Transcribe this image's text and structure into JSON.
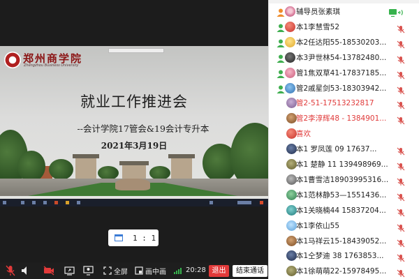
{
  "slide": {
    "top_banner": "",
    "university_cn": "郑州商学院",
    "university_en": "Zhengzhou Business University",
    "title": "就业工作推进会",
    "subtitle": "--会计学院17管会&19会计专升本",
    "date": "2021年3月19日"
  },
  "ratio_button": {
    "label": "1 : 1"
  },
  "controls": {
    "fullscreen_label": "全屏",
    "pip_label": "画中画",
    "time": "20:28",
    "exit_label": "退出",
    "end_label": "结束通话"
  },
  "colors": {
    "accent_red": "#e23a3a",
    "speaking_green": "#37b24d",
    "mic_red": "#d9534f"
  },
  "participants": [
    {
      "name": "辅导员张素琪",
      "role": "host-icon",
      "avatar": "flower",
      "red": false,
      "status": "sharing"
    },
    {
      "name": "本1李慧雪52",
      "role": "user-icon",
      "avatar": "red",
      "red": false,
      "status": "muted"
    },
    {
      "name": "本2任达阳55-18530203...",
      "role": "user-icon",
      "avatar": "emoji",
      "red": false,
      "status": "muted"
    },
    {
      "name": "本3尹世林54-13782480...",
      "role": "user-icon",
      "avatar": "dark",
      "red": false,
      "status": "muted"
    },
    {
      "name": "管1焦双草41-17837185...",
      "role": "user-icon",
      "avatar": "pink",
      "red": false,
      "status": "muted"
    },
    {
      "name": "管2戚星剑53-18303942...",
      "role": "user-icon",
      "avatar": "blue",
      "red": false,
      "status": "muted"
    },
    {
      "name": "管2-51-17513232817",
      "role": "",
      "avatar": "mauve",
      "red": true,
      "status": "muted"
    },
    {
      "name": "管2李淳辉48 - 1384901...",
      "role": "",
      "avatar": "brown",
      "red": true,
      "status": "muted"
    },
    {
      "name": "喜欢",
      "role": "",
      "avatar": "red",
      "red": true,
      "status": "none"
    },
    {
      "name": "本1  罗凤莲   09   17637...",
      "role": "",
      "avatar": "navy",
      "red": false,
      "status": "muted"
    },
    {
      "name": "本1 楚静 11 139498969...",
      "role": "",
      "avatar": "olive",
      "red": false,
      "status": "muted"
    },
    {
      "name": "本1曹雪洁18903995316...",
      "role": "",
      "avatar": "gray",
      "red": false,
      "status": "muted"
    },
    {
      "name": "本1范林静53—1551436...",
      "role": "",
      "avatar": "green",
      "red": false,
      "status": "muted"
    },
    {
      "name": "本1关晓楠44  15837204...",
      "role": "",
      "avatar": "teal",
      "red": false,
      "status": "muted"
    },
    {
      "name": "本1李依山55",
      "role": "",
      "avatar": "sky",
      "red": false,
      "status": "muted"
    },
    {
      "name": "本1马祥云15-18439052...",
      "role": "",
      "avatar": "brown",
      "red": false,
      "status": "muted"
    },
    {
      "name": "本1仝梦迪  38 1763853...",
      "role": "",
      "avatar": "navy",
      "red": false,
      "status": "muted"
    },
    {
      "name": "本1徐萌萌22-15978495...",
      "role": "",
      "avatar": "olive",
      "red": false,
      "status": "muted"
    }
  ]
}
